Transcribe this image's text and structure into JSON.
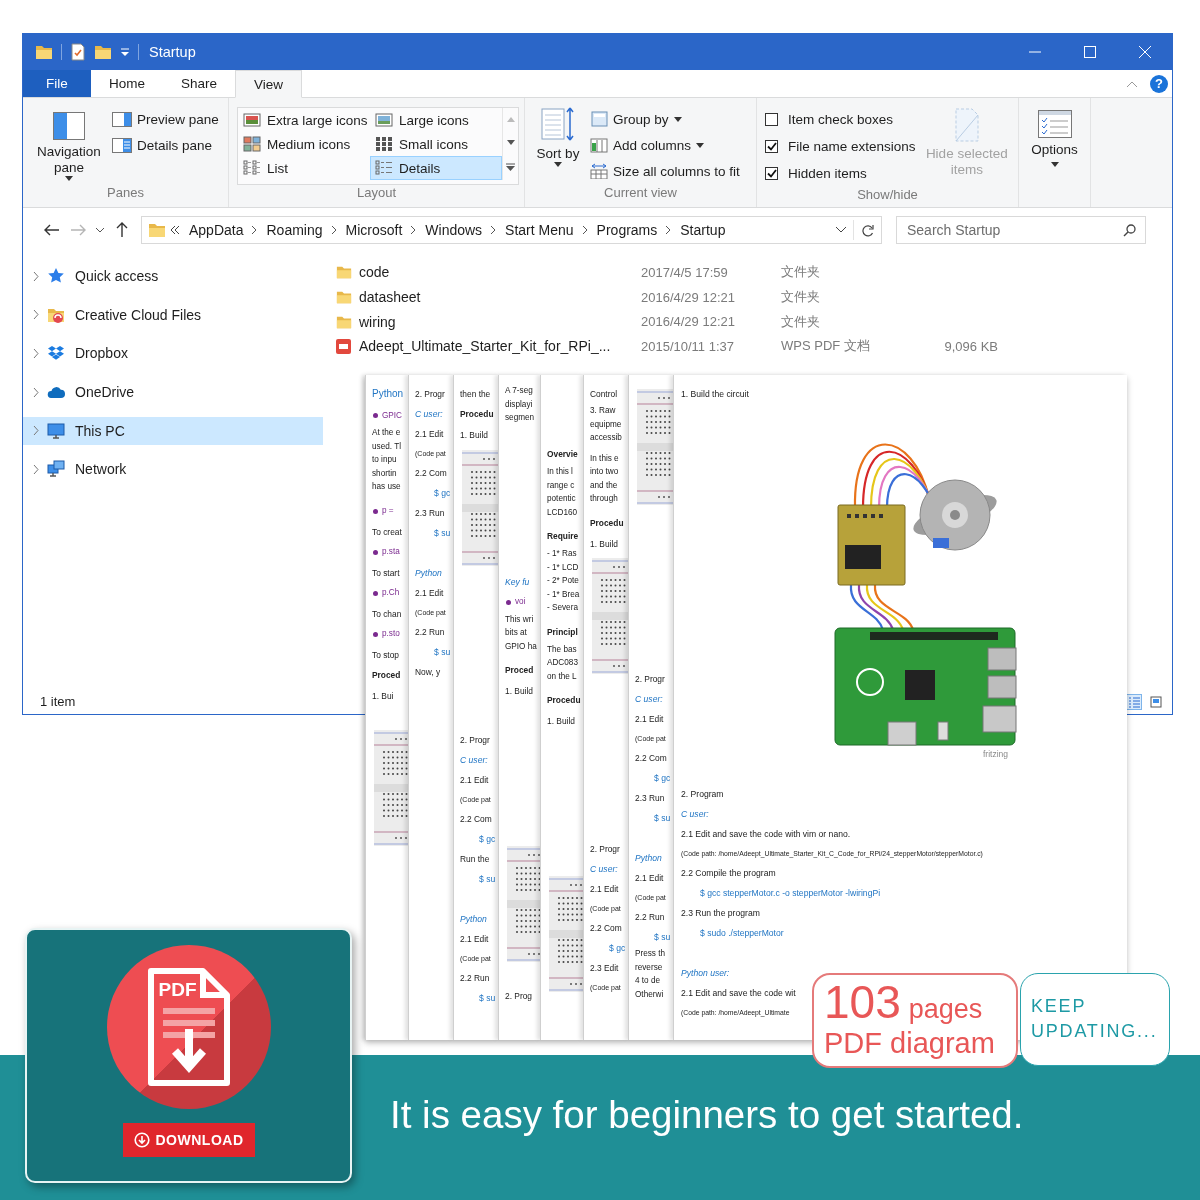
{
  "window": {
    "title": "Startup"
  },
  "ribbon_tabs": [
    {
      "label": "File",
      "kind": "file",
      "selected": false
    },
    {
      "label": "Home",
      "kind": "tab",
      "selected": false
    },
    {
      "label": "Share",
      "kind": "tab",
      "selected": false
    },
    {
      "label": "View",
      "kind": "tab",
      "selected": true
    }
  ],
  "help_button": "?",
  "ribbon": {
    "panes": {
      "label": "Panes",
      "navigation_pane": "Navigation pane",
      "items": [
        {
          "label": "Preview pane",
          "kind": "preview"
        },
        {
          "label": "Details pane",
          "kind": "details"
        }
      ]
    },
    "layout": {
      "label": "Layout",
      "options": [
        {
          "label": "Extra large icons",
          "kind": "extra-large",
          "selected": false
        },
        {
          "label": "Large icons",
          "kind": "large",
          "selected": false
        },
        {
          "label": "Medium icons",
          "kind": "medium",
          "selected": false
        },
        {
          "label": "Small icons",
          "kind": "small",
          "selected": false
        },
        {
          "label": "List",
          "kind": "list",
          "selected": false
        },
        {
          "label": "Details",
          "kind": "details",
          "selected": true
        }
      ]
    },
    "current_view": {
      "label": "Current view",
      "sort_by": "Sort by",
      "items": [
        {
          "label": "Group by",
          "kind": "group",
          "dropdown": true
        },
        {
          "label": "Add columns",
          "kind": "columns",
          "dropdown": true
        },
        {
          "label": "Size all columns to fit",
          "kind": "fit",
          "dropdown": false
        }
      ]
    },
    "show_hide": {
      "label": "Show/hide",
      "checkboxes": [
        {
          "label": "Item check boxes",
          "checked": false
        },
        {
          "label": "File name extensions",
          "checked": true
        },
        {
          "label": "Hidden items",
          "checked": true
        }
      ],
      "hide_selected": {
        "label": "Hide selected items",
        "disabled": true
      }
    },
    "options": {
      "label": "Options"
    }
  },
  "address_bar": {
    "breadcrumbs": [
      "AppData",
      "Roaming",
      "Microsoft",
      "Windows",
      "Start Menu",
      "Programs",
      "Startup"
    ],
    "forward_disabled": true,
    "search": {
      "placeholder": "Search Startup"
    }
  },
  "navigation_pane": {
    "items": [
      {
        "label": "Quick access",
        "kind": "quick-access",
        "expanded": false,
        "selected": false
      },
      {
        "label": "Creative Cloud Files",
        "kind": "creative-cloud",
        "expanded": false,
        "selected": false
      },
      {
        "label": "Dropbox",
        "kind": "dropbox",
        "expanded": false,
        "selected": false
      },
      {
        "label": "OneDrive",
        "kind": "onedrive",
        "expanded": false,
        "selected": false
      },
      {
        "label": "This PC",
        "kind": "this-pc",
        "expanded": false,
        "selected": true
      },
      {
        "label": "Network",
        "kind": "network",
        "expanded": false,
        "selected": false
      }
    ]
  },
  "files": [
    {
      "name": "code",
      "kind": "folder",
      "date": "2017/4/5 17:59",
      "type": "文件夹"
    },
    {
      "name": "datasheet",
      "kind": "folder",
      "date": "2016/4/29 12:21",
      "type": "文件夹"
    },
    {
      "name": "wiring",
      "kind": "folder",
      "date": "2016/4/29 12:21",
      "type": "文件夹"
    },
    {
      "name": "Adeept_Ultimate_Starter_Kit_for_RPi_...",
      "kind": "pdf",
      "date": "2015/10/11 1:37",
      "type": "WPS PDF 文档",
      "size": "9,096 KB"
    }
  ],
  "status_bar": {
    "item_count": "1 item",
    "view_buttons": [
      {
        "kind": "details",
        "selected": true
      },
      {
        "kind": "large-icons",
        "selected": false
      }
    ]
  },
  "document_pages": [
    {
      "lines": [
        {
          "kind": "title",
          "text": "Python"
        },
        {
          "kind": "bullet",
          "text": "GPIC"
        },
        {
          "kind": "para",
          "lines": [
            "At the e",
            "used. Tl",
            "to inpu",
            "shortin",
            "has use"
          ]
        },
        {
          "kind": "bullet",
          "text": "p ="
        },
        {
          "kind": "text",
          "text": "To creat"
        },
        {
          "kind": "bullet",
          "text": "p.sta"
        },
        {
          "kind": "text",
          "text": "To start"
        },
        {
          "kind": "bullet",
          "text": "p.Ch"
        },
        {
          "kind": "text",
          "text": "To chan"
        },
        {
          "kind": "bullet",
          "text": "p.sto"
        },
        {
          "kind": "text",
          "text": "To stop"
        },
        {
          "kind": "bold",
          "text": "Proced"
        },
        {
          "kind": "text",
          "text": "1. Bui"
        },
        {
          "kind": "gap"
        },
        {
          "kind": "board"
        }
      ]
    },
    {
      "lines": [
        {
          "kind": "text",
          "text": "2. Progr"
        },
        {
          "kind": "italic",
          "text": "C user:"
        },
        {
          "kind": "text",
          "text": "2.1 Edit"
        },
        {
          "kind": "path",
          "text": "(Code pat"
        },
        {
          "kind": "text",
          "text": "2.2 Com"
        },
        {
          "kind": "code",
          "text": "$ gc"
        },
        {
          "kind": "text",
          "text": "2.3 Run"
        },
        {
          "kind": "code",
          "text": "$ su"
        },
        {
          "kind": "gap"
        },
        {
          "kind": "italic",
          "text": "Python"
        },
        {
          "kind": "text",
          "text": "2.1 Edit"
        },
        {
          "kind": "path",
          "text": "(Code pat"
        },
        {
          "kind": "text",
          "text": "2.2 Run"
        },
        {
          "kind": "code",
          "text": "$ su"
        },
        {
          "kind": "text",
          "text": "Now, y"
        }
      ]
    },
    {
      "lines": [
        {
          "kind": "text",
          "text": "then the"
        },
        {
          "kind": "bold",
          "text": "Procedu"
        },
        {
          "kind": "text",
          "text": "1. Build"
        },
        {
          "kind": "board"
        },
        {
          "kind": "gap"
        },
        {
          "kind": "gap"
        },
        {
          "kind": "gap"
        },
        {
          "kind": "gap"
        },
        {
          "kind": "gap"
        },
        {
          "kind": "gap"
        },
        {
          "kind": "gap"
        },
        {
          "kind": "gap"
        },
        {
          "kind": "text",
          "text": "2. Progr"
        },
        {
          "kind": "italic",
          "text": "C user:"
        },
        {
          "kind": "text",
          "text": "2.1 Edit"
        },
        {
          "kind": "path",
          "text": "(Code pat"
        },
        {
          "kind": "text",
          "text": "2.2 Com"
        },
        {
          "kind": "code",
          "text": "$ gc"
        },
        {
          "kind": "text",
          "text": "Run the"
        },
        {
          "kind": "code",
          "text": "$ su"
        },
        {
          "kind": "gap"
        },
        {
          "kind": "italic",
          "text": "Python"
        },
        {
          "kind": "text",
          "text": "2.1 Edit"
        },
        {
          "kind": "path",
          "text": "(Code pat"
        },
        {
          "kind": "text",
          "text": "2.2 Run"
        },
        {
          "kind": "code",
          "text": "$ su"
        }
      ]
    },
    {
      "lines": [
        {
          "kind": "para",
          "lines": [
            "A 7-seg",
            "displayi",
            "segmen"
          ]
        },
        {
          "kind": "gap"
        },
        {
          "kind": "gap"
        },
        {
          "kind": "gap"
        },
        {
          "kind": "gap"
        },
        {
          "kind": "gap"
        },
        {
          "kind": "gap"
        },
        {
          "kind": "gap"
        },
        {
          "kind": "italic",
          "text": "Key fu"
        },
        {
          "kind": "bullet",
          "text": "voi"
        },
        {
          "kind": "para",
          "lines": [
            "This wri",
            "bits at",
            "GPIO ha"
          ]
        },
        {
          "kind": "bold",
          "text": "Proced"
        },
        {
          "kind": "text",
          "text": "1. Build"
        },
        {
          "kind": "gap"
        },
        {
          "kind": "gap"
        },
        {
          "kind": "gap"
        },
        {
          "kind": "gap"
        },
        {
          "kind": "gap"
        },
        {
          "kind": "gap"
        },
        {
          "kind": "gap"
        },
        {
          "kind": "board"
        },
        {
          "kind": "gap"
        },
        {
          "kind": "text",
          "text": "2. Prog"
        }
      ]
    },
    {
      "lines": [
        {
          "kind": "gap"
        },
        {
          "kind": "gap"
        },
        {
          "kind": "gap"
        },
        {
          "kind": "bold",
          "text": "Overvie"
        },
        {
          "kind": "para",
          "lines": [
            "In this l",
            "range c",
            "potentic",
            "LCD160"
          ]
        },
        {
          "kind": "bold",
          "text": "Require"
        },
        {
          "kind": "para",
          "lines": [
            "- 1* Ras",
            "- 1* LCD",
            "- 2* Pote",
            "- 1* Brea",
            "- Severa"
          ]
        },
        {
          "kind": "bold",
          "text": "Principl"
        },
        {
          "kind": "para",
          "lines": [
            "The bas",
            "ADC083",
            "on the L"
          ]
        },
        {
          "kind": "bold",
          "text": "Procedu"
        },
        {
          "kind": "text",
          "text": "1. Build"
        },
        {
          "kind": "gap"
        },
        {
          "kind": "gap"
        },
        {
          "kind": "gap"
        },
        {
          "kind": "gap"
        },
        {
          "kind": "gap"
        },
        {
          "kind": "gap"
        },
        {
          "kind": "gap"
        },
        {
          "kind": "board"
        }
      ]
    },
    {
      "lines": [
        {
          "kind": "text",
          "text": "Control"
        },
        {
          "kind": "para",
          "lines": [
            "3. Raw",
            "equipme",
            "accessib"
          ]
        },
        {
          "kind": "para",
          "lines": [
            "In this e",
            "into two",
            "and the",
            "through"
          ]
        },
        {
          "kind": "bold",
          "text": "Procedu"
        },
        {
          "kind": "text",
          "text": "1. Build"
        },
        {
          "kind": "board"
        },
        {
          "kind": "gap"
        },
        {
          "kind": "gap"
        },
        {
          "kind": "gap"
        },
        {
          "kind": "gap"
        },
        {
          "kind": "gap"
        },
        {
          "kind": "gap"
        },
        {
          "kind": "gap"
        },
        {
          "kind": "gap"
        },
        {
          "kind": "text",
          "text": "2. Progr"
        },
        {
          "kind": "italic",
          "text": "C user:"
        },
        {
          "kind": "text",
          "text": "2.1 Edit"
        },
        {
          "kind": "path",
          "text": "(Code pat"
        },
        {
          "kind": "text",
          "text": "2.2 Com"
        },
        {
          "kind": "code",
          "text": "$ gc"
        },
        {
          "kind": "text",
          "text": "2.3 Edit"
        },
        {
          "kind": "path",
          "text": "(Code pat"
        }
      ]
    },
    {
      "lines": [
        {
          "kind": "board"
        },
        {
          "kind": "gap"
        },
        {
          "kind": "gap"
        },
        {
          "kind": "gap"
        },
        {
          "kind": "gap"
        },
        {
          "kind": "gap"
        },
        {
          "kind": "gap"
        },
        {
          "kind": "gap"
        },
        {
          "kind": "gap"
        },
        {
          "kind": "text",
          "text": "2. Progr"
        },
        {
          "kind": "italic",
          "text": "C user:"
        },
        {
          "kind": "text",
          "text": "2.1 Edit"
        },
        {
          "kind": "path",
          "text": "(Code pat"
        },
        {
          "kind": "text",
          "text": "2.2 Com"
        },
        {
          "kind": "code",
          "text": "$ gc"
        },
        {
          "kind": "text",
          "text": "2.3 Run"
        },
        {
          "kind": "code",
          "text": "$ su"
        },
        {
          "kind": "gap"
        },
        {
          "kind": "italic",
          "text": "Python"
        },
        {
          "kind": "text",
          "text": "2.1 Edit"
        },
        {
          "kind": "path",
          "text": "(Code pat"
        },
        {
          "kind": "text",
          "text": "2.2 Run"
        },
        {
          "kind": "code",
          "text": "$ su"
        },
        {
          "kind": "para",
          "lines": [
            "Press th",
            "reverse",
            "4 to de",
            "Otherwi"
          ]
        }
      ]
    }
  ],
  "main_page": {
    "lines": [
      {
        "kind": "text",
        "text": "1. Build the circuit"
      },
      {
        "kind": "circuit"
      },
      {
        "kind": "caption",
        "text": "fritzing"
      },
      {
        "kind": "gap"
      },
      {
        "kind": "text",
        "text": "2. Program"
      },
      {
        "kind": "italic",
        "text": "C user:"
      },
      {
        "kind": "text",
        "text": "2.1 Edit and save the code with vim or nano."
      },
      {
        "kind": "path",
        "text": "(Code path: /home/Adeept_Ultimate_Starter_Kit_C_Code_for_RPi/24_stepperMotor/stepperMotor.c)"
      },
      {
        "kind": "text",
        "text": "2.2 Compile the program"
      },
      {
        "kind": "code",
        "text": "$ gcc stepperMotor.c -o stepperMotor -lwiringPi"
      },
      {
        "kind": "text",
        "text": "2.3 Run the program"
      },
      {
        "kind": "code",
        "text": "$ sudo ./stepperMotor"
      },
      {
        "kind": "gap"
      },
      {
        "kind": "italic",
        "text": "Python user:"
      },
      {
        "kind": "text",
        "text": "2.1 Edit and save the code wit"
      },
      {
        "kind": "path",
        "text": "(Code path: /home/Adeept_Ultimate"
      }
    ]
  },
  "download_card": {
    "icon_label": "PDF",
    "button": "DOWNLOAD"
  },
  "pages_badge": {
    "count": "103",
    "unit": "pages",
    "subtitle": "PDF diagram"
  },
  "update_badge": {
    "text": "KEEP UPDATING..."
  },
  "slogan": "It is easy for beginners to get started."
}
